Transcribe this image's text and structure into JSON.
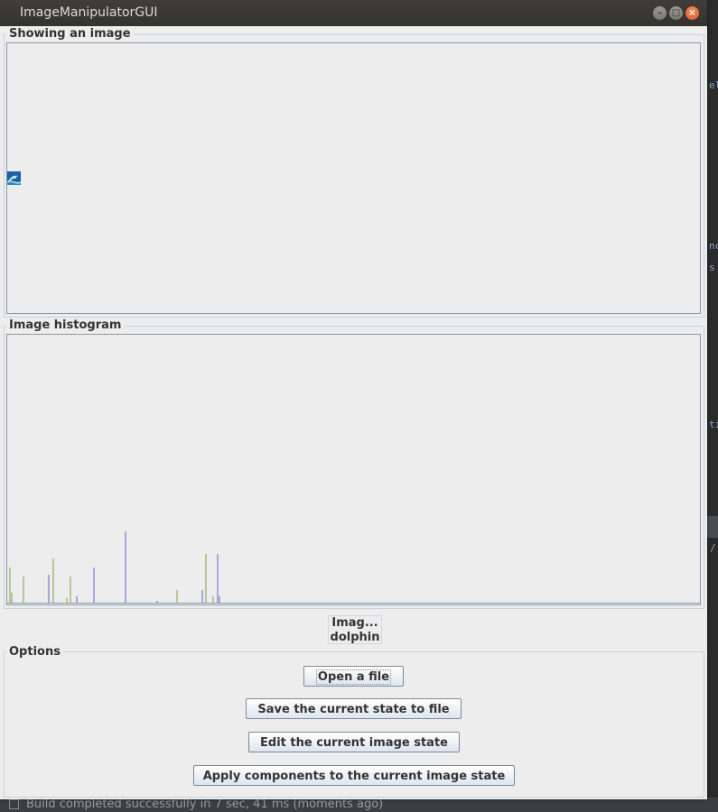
{
  "window": {
    "title": "ImageManipulatorGUI",
    "controls": {
      "minimize": "–",
      "maximize": "□",
      "close": "×"
    }
  },
  "image_panel": {
    "title": "Showing an image",
    "thumbnail_icon": "dolphin-image-thumbnail"
  },
  "histogram_panel": {
    "title": "Image histogram",
    "colors": {
      "green": "#7fa13c",
      "blue": "#6b5fc6",
      "baseline": "#8a99a8"
    }
  },
  "image_label": {
    "line1": "Imag...",
    "line2": "dolphin"
  },
  "options": {
    "title": "Options",
    "buttons": [
      {
        "label": "Open a file"
      },
      {
        "label": "Save the current state to file"
      },
      {
        "label": "Edit the current image state"
      },
      {
        "label": "Apply components to the current image state"
      }
    ]
  },
  "background_status": "Build completed successfully in 7 sec, 41 ms (moments ago)"
}
